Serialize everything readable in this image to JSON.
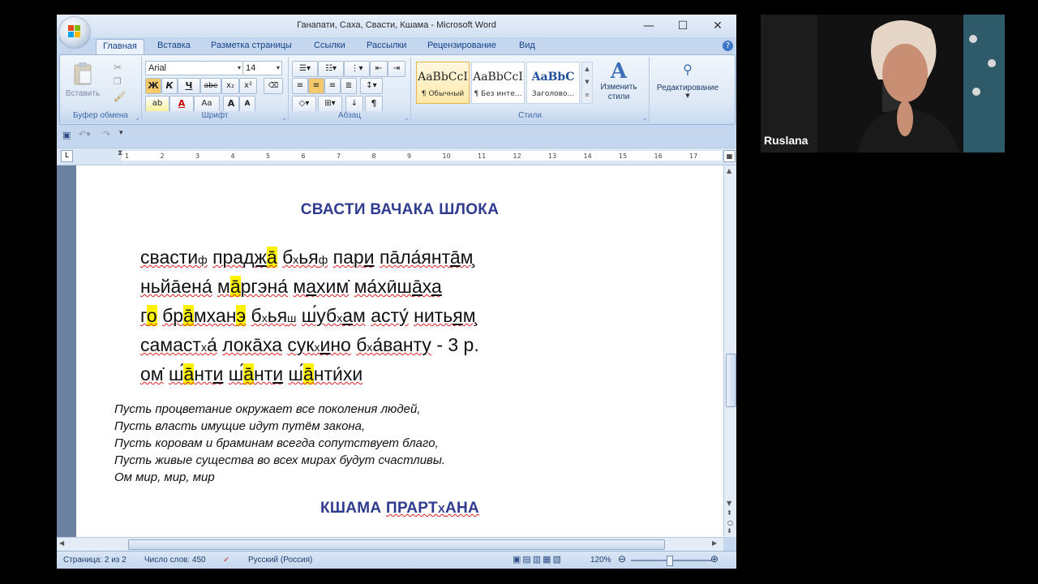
{
  "window": {
    "title": "Ганапати, Саха, Свасти, Кшама - Microsoft Word",
    "minimize_glyph": "—",
    "maximize_glyph": "☐",
    "close_glyph": "✕"
  },
  "ribbon_tabs": [
    {
      "label": "Главная",
      "active": true
    },
    {
      "label": "Вставка"
    },
    {
      "label": "Разметка страницы"
    },
    {
      "label": "Ссылки"
    },
    {
      "label": "Рассылки"
    },
    {
      "label": "Рецензирование"
    },
    {
      "label": "Вид"
    }
  ],
  "ribbon": {
    "clipboard": {
      "paste_label": "Вставить",
      "group_label": "Буфер обмена"
    },
    "font": {
      "font_name": "Arial",
      "font_size": "14",
      "group_label": "Шрифт",
      "bold": "Ж",
      "italic": "К",
      "underline": "Ч",
      "strike": "abe",
      "subscript": "x₂",
      "superscript": "x²",
      "highlight": "ab",
      "font_color": "A",
      "change_case": "Aa",
      "grow": "A",
      "shrink": "A"
    },
    "paragraph": {
      "group_label": "Абзац"
    },
    "styles": {
      "group_label": "Стили",
      "items": [
        {
          "sample": "AaBbCcI",
          "name": "¶ Обычный",
          "selected": true
        },
        {
          "sample": "AaBbCcI",
          "name": "¶ Без инте..."
        },
        {
          "sample": "AaBbC",
          "name": "Заголово..."
        }
      ],
      "change_styles_label": "Изменить стили"
    },
    "editing": {
      "label": "Редактирование"
    }
  },
  "ruler_numbers": [
    "1",
    "2",
    "3",
    "4",
    "5",
    "6",
    "7",
    "8",
    "9",
    "10",
    "11",
    "12",
    "13",
    "14",
    "15",
    "16",
    "17"
  ],
  "document": {
    "heading1": "СВАСТИ ВАЧАКА  ШЛОКА",
    "heading2_parts": [
      "КШАМА ",
      "ПРАРТ",
      "Х",
      "АНА"
    ],
    "mantra_suffix": "   - 3 р.",
    "translation": [
      "Пусть процветание окружает все поколения людей,",
      "Пусть власть имущие идут путём закона,",
      "Пусть коровам и браминам всегда сопутствует благо,",
      "Пусть живые существа во всех мирах будут счастливы.",
      "Ом мир, мир, мир"
    ]
  },
  "status": {
    "page": "Страница: 2 из 2",
    "words": "Число слов: 450",
    "language": "Русский (Россия)",
    "zoom": "120%"
  },
  "participant": {
    "name": "Ruslana"
  },
  "colors": {
    "heading": "#2f3b8f",
    "highlight": "#fff200",
    "chrome": "#c5d7ee"
  }
}
